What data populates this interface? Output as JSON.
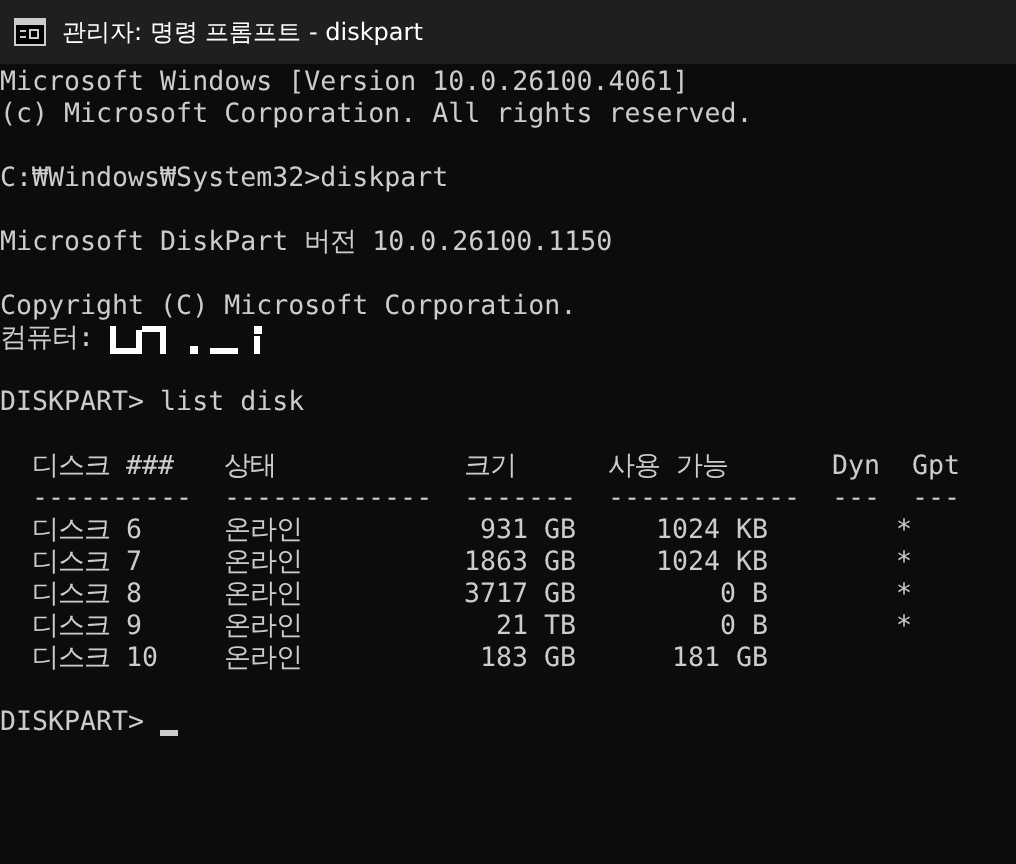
{
  "window": {
    "title": "관리자: 명령 프롬프트 - diskpart"
  },
  "console": {
    "lines": [
      {
        "kind": "text",
        "text": "Microsoft Windows [Version 10.0.26100.4061]"
      },
      {
        "kind": "text",
        "text": "(c) Microsoft Corporation. All rights reserved."
      },
      {
        "kind": "blank"
      },
      {
        "kind": "text",
        "text": "C:₩Windows₩System32>diskpart"
      },
      {
        "kind": "blank"
      },
      {
        "kind": "text",
        "text": "Microsoft DiskPart 버전 10.0.26100.1150"
      },
      {
        "kind": "blank"
      },
      {
        "kind": "text",
        "text": "Copyright (C) Microsoft Corporation."
      },
      {
        "kind": "computer",
        "label": "컴퓨터:"
      },
      {
        "kind": "blank"
      },
      {
        "kind": "text",
        "text": "DISKPART> list disk"
      },
      {
        "kind": "blank"
      },
      {
        "kind": "table",
        "columns": [
          {
            "label": "디스크 ###",
            "rule": "----------"
          },
          {
            "label": "상태",
            "rule": "-------------"
          },
          {
            "label": "크기",
            "rule": "-------"
          },
          {
            "label": "사용 가능",
            "rule": "------------"
          },
          {
            "label": "Dyn",
            "rule": "---"
          },
          {
            "label": "Gpt",
            "rule": "---"
          }
        ],
        "rows": [
          {
            "cells": [
              "디스크 6",
              "온라인",
              "931 GB",
              "1024 KB"
            ],
            "gpt": "*"
          },
          {
            "cells": [
              "디스크 7",
              "온라인",
              "1863 GB",
              "1024 KB"
            ],
            "gpt": "*"
          },
          {
            "cells": [
              "디스크 8",
              "온라인",
              "3717 GB",
              "0 B"
            ],
            "gpt": "*"
          },
          {
            "cells": [
              "디스크 9",
              "온라인",
              "21 TB",
              "0 B"
            ],
            "gpt": "*"
          },
          {
            "cells": [
              "디스크 10",
              "온라인",
              "183 GB",
              "181 GB"
            ]
          }
        ]
      },
      {
        "kind": "blank"
      },
      {
        "kind": "prompt",
        "text": "DISKPART>",
        "cursor": true
      }
    ]
  }
}
